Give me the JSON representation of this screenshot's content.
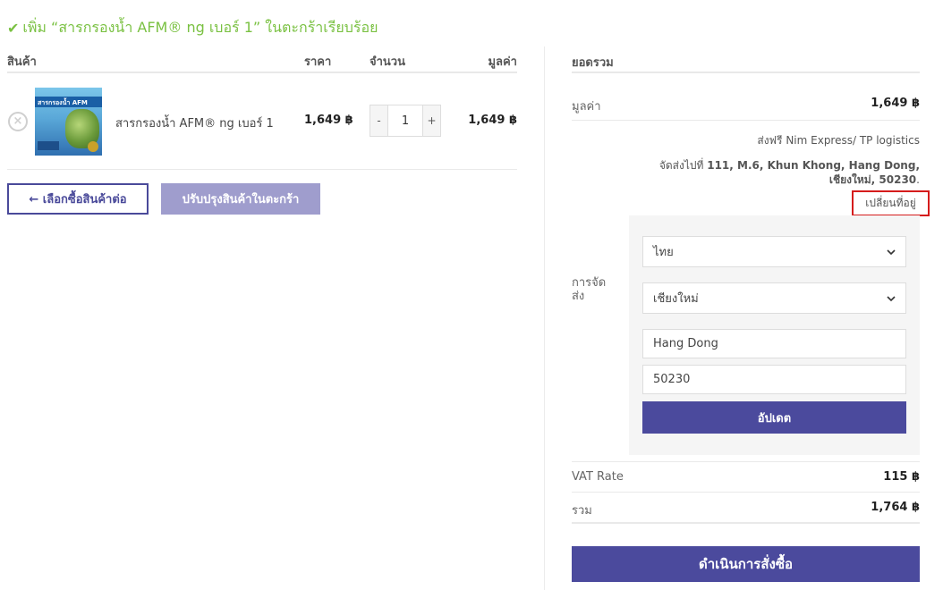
{
  "notice": {
    "text": "เพิ่ม “สารกรองน้ำ AFM® ng เบอร์ 1” ในตะกร้าเรียบร้อย",
    "color": "#7ac142"
  },
  "cart": {
    "headers": {
      "product": "สินค้า",
      "price": "ราคา",
      "quantity": "จำนวน",
      "subtotal": "มูลค่า"
    },
    "items": [
      {
        "name": "สารกรองน้ำ AFM® ng เบอร์ 1",
        "image_text": "สารกรองน้ำ AFM",
        "price": "1,649 ฿",
        "quantity": "1",
        "subtotal": "1,649 ฿",
        "qty_minus": "-",
        "qty_plus": "+",
        "remove_icon": "×"
      }
    ],
    "continue_label": "← เลือกซื้อสินค้าต่อ",
    "update_label": "ปรับปรุงสินค้าในตะกร้า"
  },
  "totals": {
    "title": "ยอดรวม",
    "subtotal_label": "มูลค่า",
    "subtotal_value": "1,649 ฿",
    "shipping_label": "การจัดส่ง",
    "shipping_method": "ส่งฟรี Nim Express/ TP logistics",
    "shipping_dest_prefix": "จัดส่งไปที่",
    "shipping_dest_address": "111, M.6, Khun Khong, Hang Dong, เชียงใหม่, 50230",
    "shipping_dest_suffix": ".",
    "change_address_label": "เปลี่ยนที่อยู่",
    "calculator": {
      "country": "ไทย",
      "province": "เชียงใหม่",
      "city": "Hang Dong",
      "postcode": "50230",
      "update_label": "อัปเดต"
    },
    "vat_label": "VAT Rate",
    "vat_value": "115 ฿",
    "total_label": "รวม",
    "total_value": "1,764 ฿",
    "checkout_label": "ดำเนินการสั่งซื้อ"
  },
  "colors": {
    "accent": "#4b4a9d",
    "accent_light": "#9f9dcd",
    "highlight_border": "#d51c1c"
  }
}
